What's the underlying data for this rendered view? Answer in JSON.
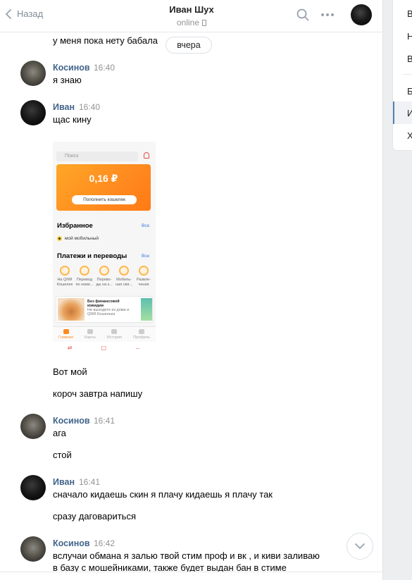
{
  "header": {
    "back_label": "Назад",
    "title": "Иван Шух",
    "status": "online"
  },
  "date_divider": "вчера",
  "messages": [
    {
      "text": "у меня пока нету бабала"
    },
    {
      "author": "Косинов",
      "time": "16:40",
      "lines": [
        "я знаю"
      ]
    },
    {
      "author": "Иван",
      "time": "16:40",
      "lines": [
        "щас кину"
      ]
    },
    {
      "lines": [
        "Вот мой",
        "короч завтра напишу"
      ]
    },
    {
      "author": "Косинов",
      "time": "16:41",
      "lines": [
        "ага",
        "стой"
      ]
    },
    {
      "author": "Иван",
      "time": "16:41",
      "lines": [
        "сначало кидаешь скин я плачу кидаешь я плачу так",
        "сразу даговариться"
      ]
    },
    {
      "author": "Косинов",
      "time": "16:42",
      "lines": [
        "вслучаи обмана я залью твой стим проф и вк , и киви заливаю",
        "в базу с мошейниками, также будет выдан бан в стиме"
      ]
    }
  ],
  "attachment": {
    "search_placeholder": "Поиск",
    "balance": "0,16 ₽",
    "topup_button": "Пополнить кошелек",
    "favorites_title": "Избранное",
    "favorites_all": "Все",
    "favorite_item": "мой мобильный",
    "payments_title": "Платежи и переводы",
    "payments_all": "Все",
    "payment_icons": [
      {
        "line1": "На QIWI",
        "line2": "Кошелек"
      },
      {
        "line1": "Перевод",
        "line2": "по номе..."
      },
      {
        "line1": "Перево-",
        "line2": "ды на к..."
      },
      {
        "line1": "Мобиль-",
        "line2": "ная свя..."
      },
      {
        "line1": "Развле-",
        "line2": "чения"
      }
    ],
    "banner_title": "Без финансовой ковидии",
    "banner_sub": "Не выходите из дома и QIWI Кошелька",
    "tabs": [
      "Главная",
      "Карты",
      "История",
      "Профиль"
    ]
  },
  "right_panel": {
    "items": [
      "В",
      "Н",
      "В",
      "Б",
      "И",
      "Х"
    ]
  }
}
